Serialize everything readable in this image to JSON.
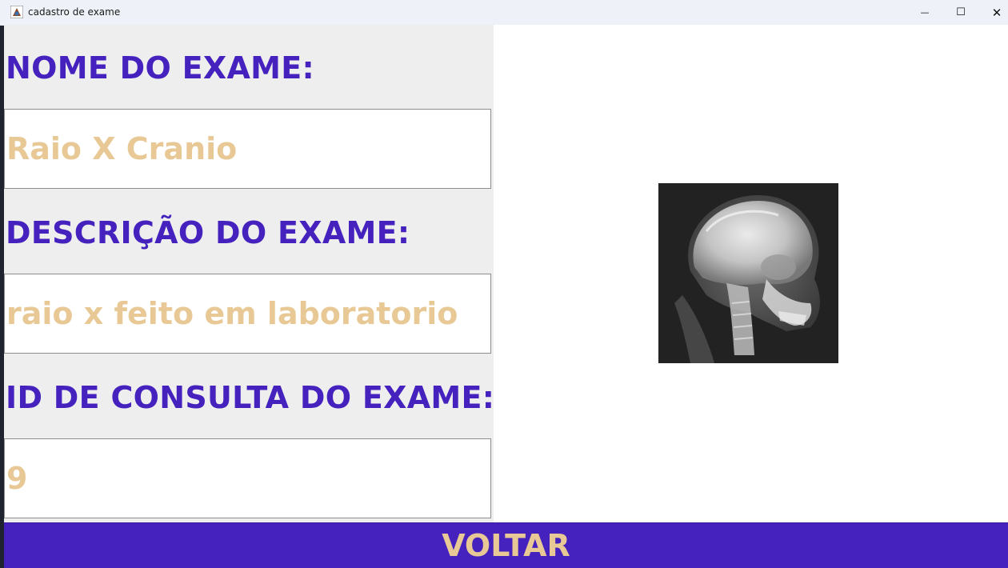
{
  "window": {
    "title": "cadastro de exame",
    "minimize_glyph": "—",
    "maximize_glyph": "☐",
    "close_glyph": "✕"
  },
  "form": {
    "name_label": "NOME DO EXAME:",
    "name_value": "Raio X Cranio",
    "description_label": "DESCRIÇÃO DO EXAME:",
    "description_value": "raio x feito em laboratorio",
    "consulta_label": "ID DE CONSULTA DO EXAME:",
    "consulta_value": "9"
  },
  "image": {
    "icon": "skull-xray-image"
  },
  "actions": {
    "back_label": "VOLTAR"
  },
  "colors": {
    "label_purple": "#4522be",
    "value_gold": "#e8c995",
    "button_bg": "#4522be"
  }
}
